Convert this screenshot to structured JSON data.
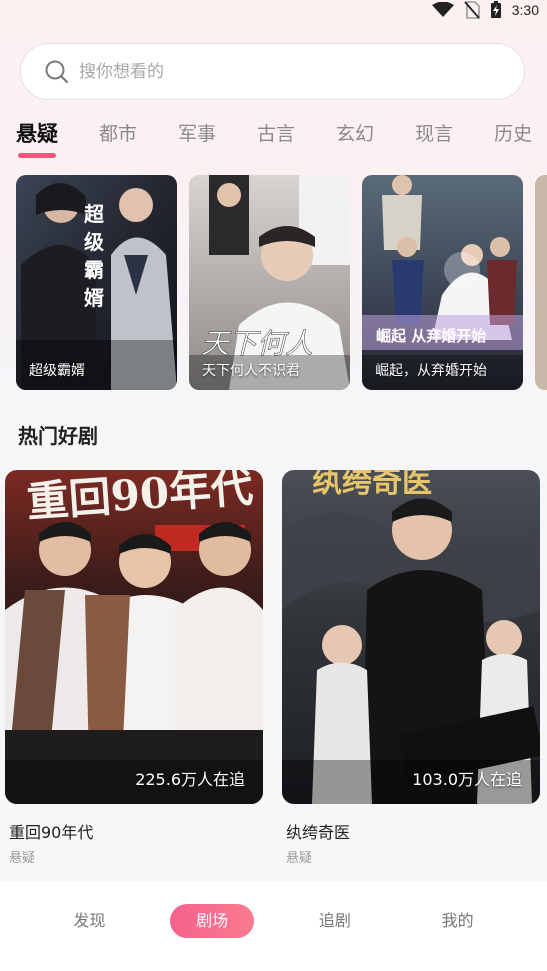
{
  "status_bar": {
    "time": "3:30",
    "icons": [
      "wifi-icon",
      "no-sim-icon",
      "battery-charging-icon"
    ]
  },
  "search": {
    "placeholder": "搜你想看的",
    "icon": "search-icon"
  },
  "tabs": [
    "悬疑",
    "都市",
    "军事",
    "古言",
    "玄幻",
    "现言",
    "历史"
  ],
  "active_tab": "悬疑",
  "featured": [
    {
      "title": "超级霸婿",
      "poster_text": "超级霸婿"
    },
    {
      "title": "天下何人不识君",
      "poster_text": "天下何人"
    },
    {
      "title": "崛起，从弃婚开始",
      "poster_text": "崛起 从弃婚开始"
    }
  ],
  "section": {
    "title": "热门好剧"
  },
  "hot": [
    {
      "title": "重回90年代",
      "genre": "悬疑",
      "views": "225.6万人在追"
    },
    {
      "title": "纨绔奇医",
      "genre": "悬疑",
      "views": "103.0万人在追"
    }
  ],
  "bottom_nav": [
    "发现",
    "剧场",
    "追剧",
    "我的"
  ],
  "colors": {
    "accent": "#f1567f",
    "nav_active": "#f4628d"
  }
}
